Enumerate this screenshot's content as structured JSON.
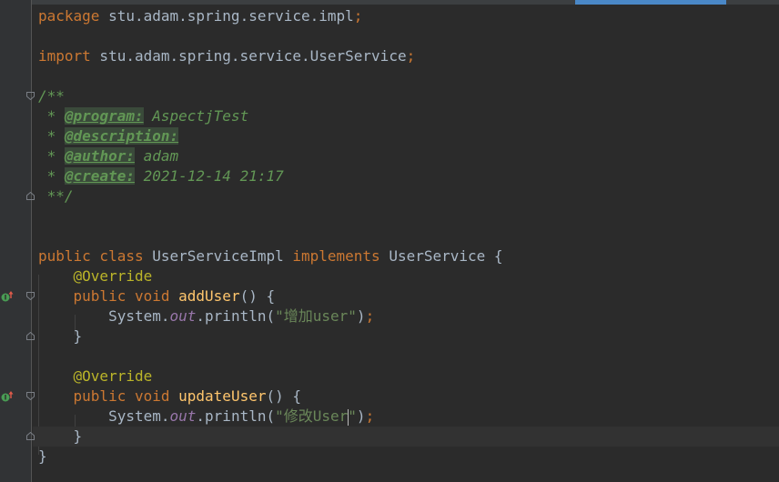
{
  "editor": {
    "language": "java",
    "current_line": 21,
    "colors": {
      "background": "#2b2b2b",
      "gutter": "#313335",
      "keyword": "#cc7832",
      "text": "#a9b7c6",
      "annotation": "#bbb529",
      "method": "#ffc66d",
      "static_field": "#9876aa",
      "string": "#6a8759",
      "doc_comment": "#629755"
    },
    "lines": [
      {
        "tokens": [
          [
            "kw",
            "package"
          ],
          [
            "txt",
            " stu.adam.spring.service.impl"
          ],
          [
            "kw",
            ";"
          ]
        ]
      },
      {
        "tokens": []
      },
      {
        "tokens": [
          [
            "kw",
            "import"
          ],
          [
            "txt",
            " stu.adam.spring.service.UserService"
          ],
          [
            "kw",
            ";"
          ]
        ]
      },
      {
        "tokens": []
      },
      {
        "tokens": [
          [
            "doc",
            "/**"
          ]
        ]
      },
      {
        "tokens": [
          [
            "doc",
            " * "
          ],
          [
            "doctag",
            "@program:"
          ],
          [
            "doc",
            " AspectjTest"
          ]
        ]
      },
      {
        "tokens": [
          [
            "doc",
            " * "
          ],
          [
            "doctag",
            "@description:"
          ]
        ]
      },
      {
        "tokens": [
          [
            "doc",
            " * "
          ],
          [
            "doctag",
            "@author:"
          ],
          [
            "doc",
            " adam"
          ]
        ]
      },
      {
        "tokens": [
          [
            "doc",
            " * "
          ],
          [
            "doctag",
            "@create:"
          ],
          [
            "doc",
            " 2021-12-14 21:17"
          ]
        ]
      },
      {
        "tokens": [
          [
            "doc",
            " **/"
          ]
        ]
      },
      {
        "tokens": []
      },
      {
        "tokens": []
      },
      {
        "tokens": [
          [
            "kw",
            "public class"
          ],
          [
            "txt",
            " UserServiceImpl "
          ],
          [
            "kw",
            "implements"
          ],
          [
            "txt",
            " UserService {"
          ]
        ]
      },
      {
        "tokens": [
          [
            "txt",
            "    "
          ],
          [
            "ann",
            "@Override"
          ]
        ]
      },
      {
        "tokens": [
          [
            "txt",
            "    "
          ],
          [
            "kw",
            "public void"
          ],
          [
            "txt",
            " "
          ],
          [
            "method",
            "addUser"
          ],
          [
            "txt",
            "() {"
          ]
        ]
      },
      {
        "tokens": [
          [
            "txt",
            "        System."
          ],
          [
            "field",
            "out"
          ],
          [
            "txt",
            ".println("
          ],
          [
            "str",
            "\"增加user\""
          ],
          [
            "txt",
            ")"
          ],
          [
            "kw",
            ";"
          ]
        ]
      },
      {
        "tokens": [
          [
            "txt",
            "    }"
          ]
        ]
      },
      {
        "tokens": []
      },
      {
        "tokens": [
          [
            "txt",
            "    "
          ],
          [
            "ann",
            "@Override"
          ]
        ]
      },
      {
        "tokens": [
          [
            "txt",
            "    "
          ],
          [
            "kw",
            "public void"
          ],
          [
            "txt",
            " "
          ],
          [
            "method",
            "updateUser"
          ],
          [
            "txt",
            "() {"
          ]
        ]
      },
      {
        "tokens": [
          [
            "txt",
            "        System."
          ],
          [
            "field",
            "out"
          ],
          [
            "txt",
            ".println("
          ],
          [
            "str",
            "\"修改User"
          ],
          [
            "caret",
            ""
          ],
          [
            "str",
            "\""
          ],
          [
            "txt",
            ")"
          ],
          [
            "kw",
            ";"
          ]
        ]
      },
      {
        "tokens": [
          [
            "txt",
            "    }"
          ]
        ]
      },
      {
        "tokens": [
          [
            "txt",
            "}"
          ]
        ]
      }
    ],
    "fold_markers": [
      {
        "line": 4,
        "kind": "open"
      },
      {
        "line": 9,
        "kind": "close"
      },
      {
        "line": 14,
        "kind": "open"
      },
      {
        "line": 16,
        "kind": "close"
      },
      {
        "line": 19,
        "kind": "open"
      },
      {
        "line": 21,
        "kind": "close"
      }
    ],
    "gutter_icons": [
      {
        "line": 14,
        "icon": "implements-method-icon"
      },
      {
        "line": 19,
        "icon": "implements-method-icon"
      }
    ]
  }
}
